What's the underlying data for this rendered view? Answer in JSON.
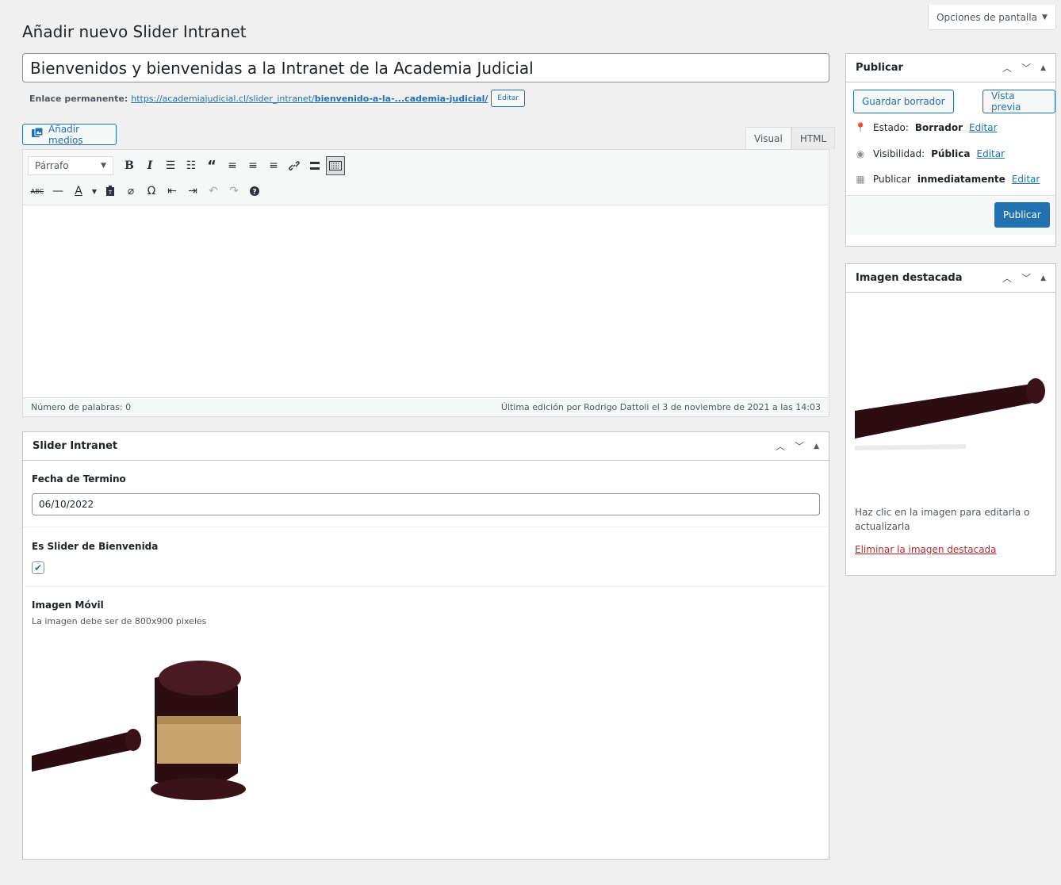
{
  "screen_options": {
    "label": "Opciones de pantalla",
    "arrow": "▼"
  },
  "page_title": "Añadir nuevo Slider Intranet",
  "post_title": "Bienvenidos y bienvenidas a la Intranet de la Academia Judicial",
  "permalink": {
    "label": "Enlace permanente:",
    "url_prefix": "https://academiajudicial.cl/slider_intranet/",
    "url_slug": "bienvenido-a-la-...cademia-judicial/",
    "edit_label": "Editar"
  },
  "add_media_label": "Añadir medios",
  "editor": {
    "tabs": [
      "Visual",
      "HTML"
    ],
    "active_tab": "Visual",
    "format_select": "Párrafo",
    "word_count": "Número de palabras: 0",
    "last_edit": "Última edición por Rodrigo Dattoli el 3 de noviembre de 2021 a las 14:03"
  },
  "slider_box": {
    "title": "Slider Intranet",
    "end_date_label": "Fecha de Termino",
    "end_date_value": "06/10/2022",
    "welcome_label": "Es Slider de Bienvenida",
    "welcome_checked": true,
    "mobile_image_label": "Imagen Móvil",
    "mobile_image_help": "La imagen debe ser de 800x900 pixeles"
  },
  "publish_box": {
    "title": "Publicar",
    "save_draft": "Guardar borrador",
    "preview": "Vista previa",
    "status_label": "Estado:",
    "status_value": "Borrador",
    "visibility_label": "Visibilidad:",
    "visibility_value": "Pública",
    "publish_label": "Publicar",
    "publish_value": "inmediatamente",
    "edit_link": "Editar",
    "publish_button": "Publicar"
  },
  "featured_box": {
    "title": "Imagen destacada",
    "help": "Haz clic en la imagen para editarla o actualizarla",
    "remove": "Eliminar la imagen destacada"
  },
  "colors": {
    "accent": "#2271b1",
    "background": "#f0f0f1",
    "remove_link": "#b32d2e"
  }
}
